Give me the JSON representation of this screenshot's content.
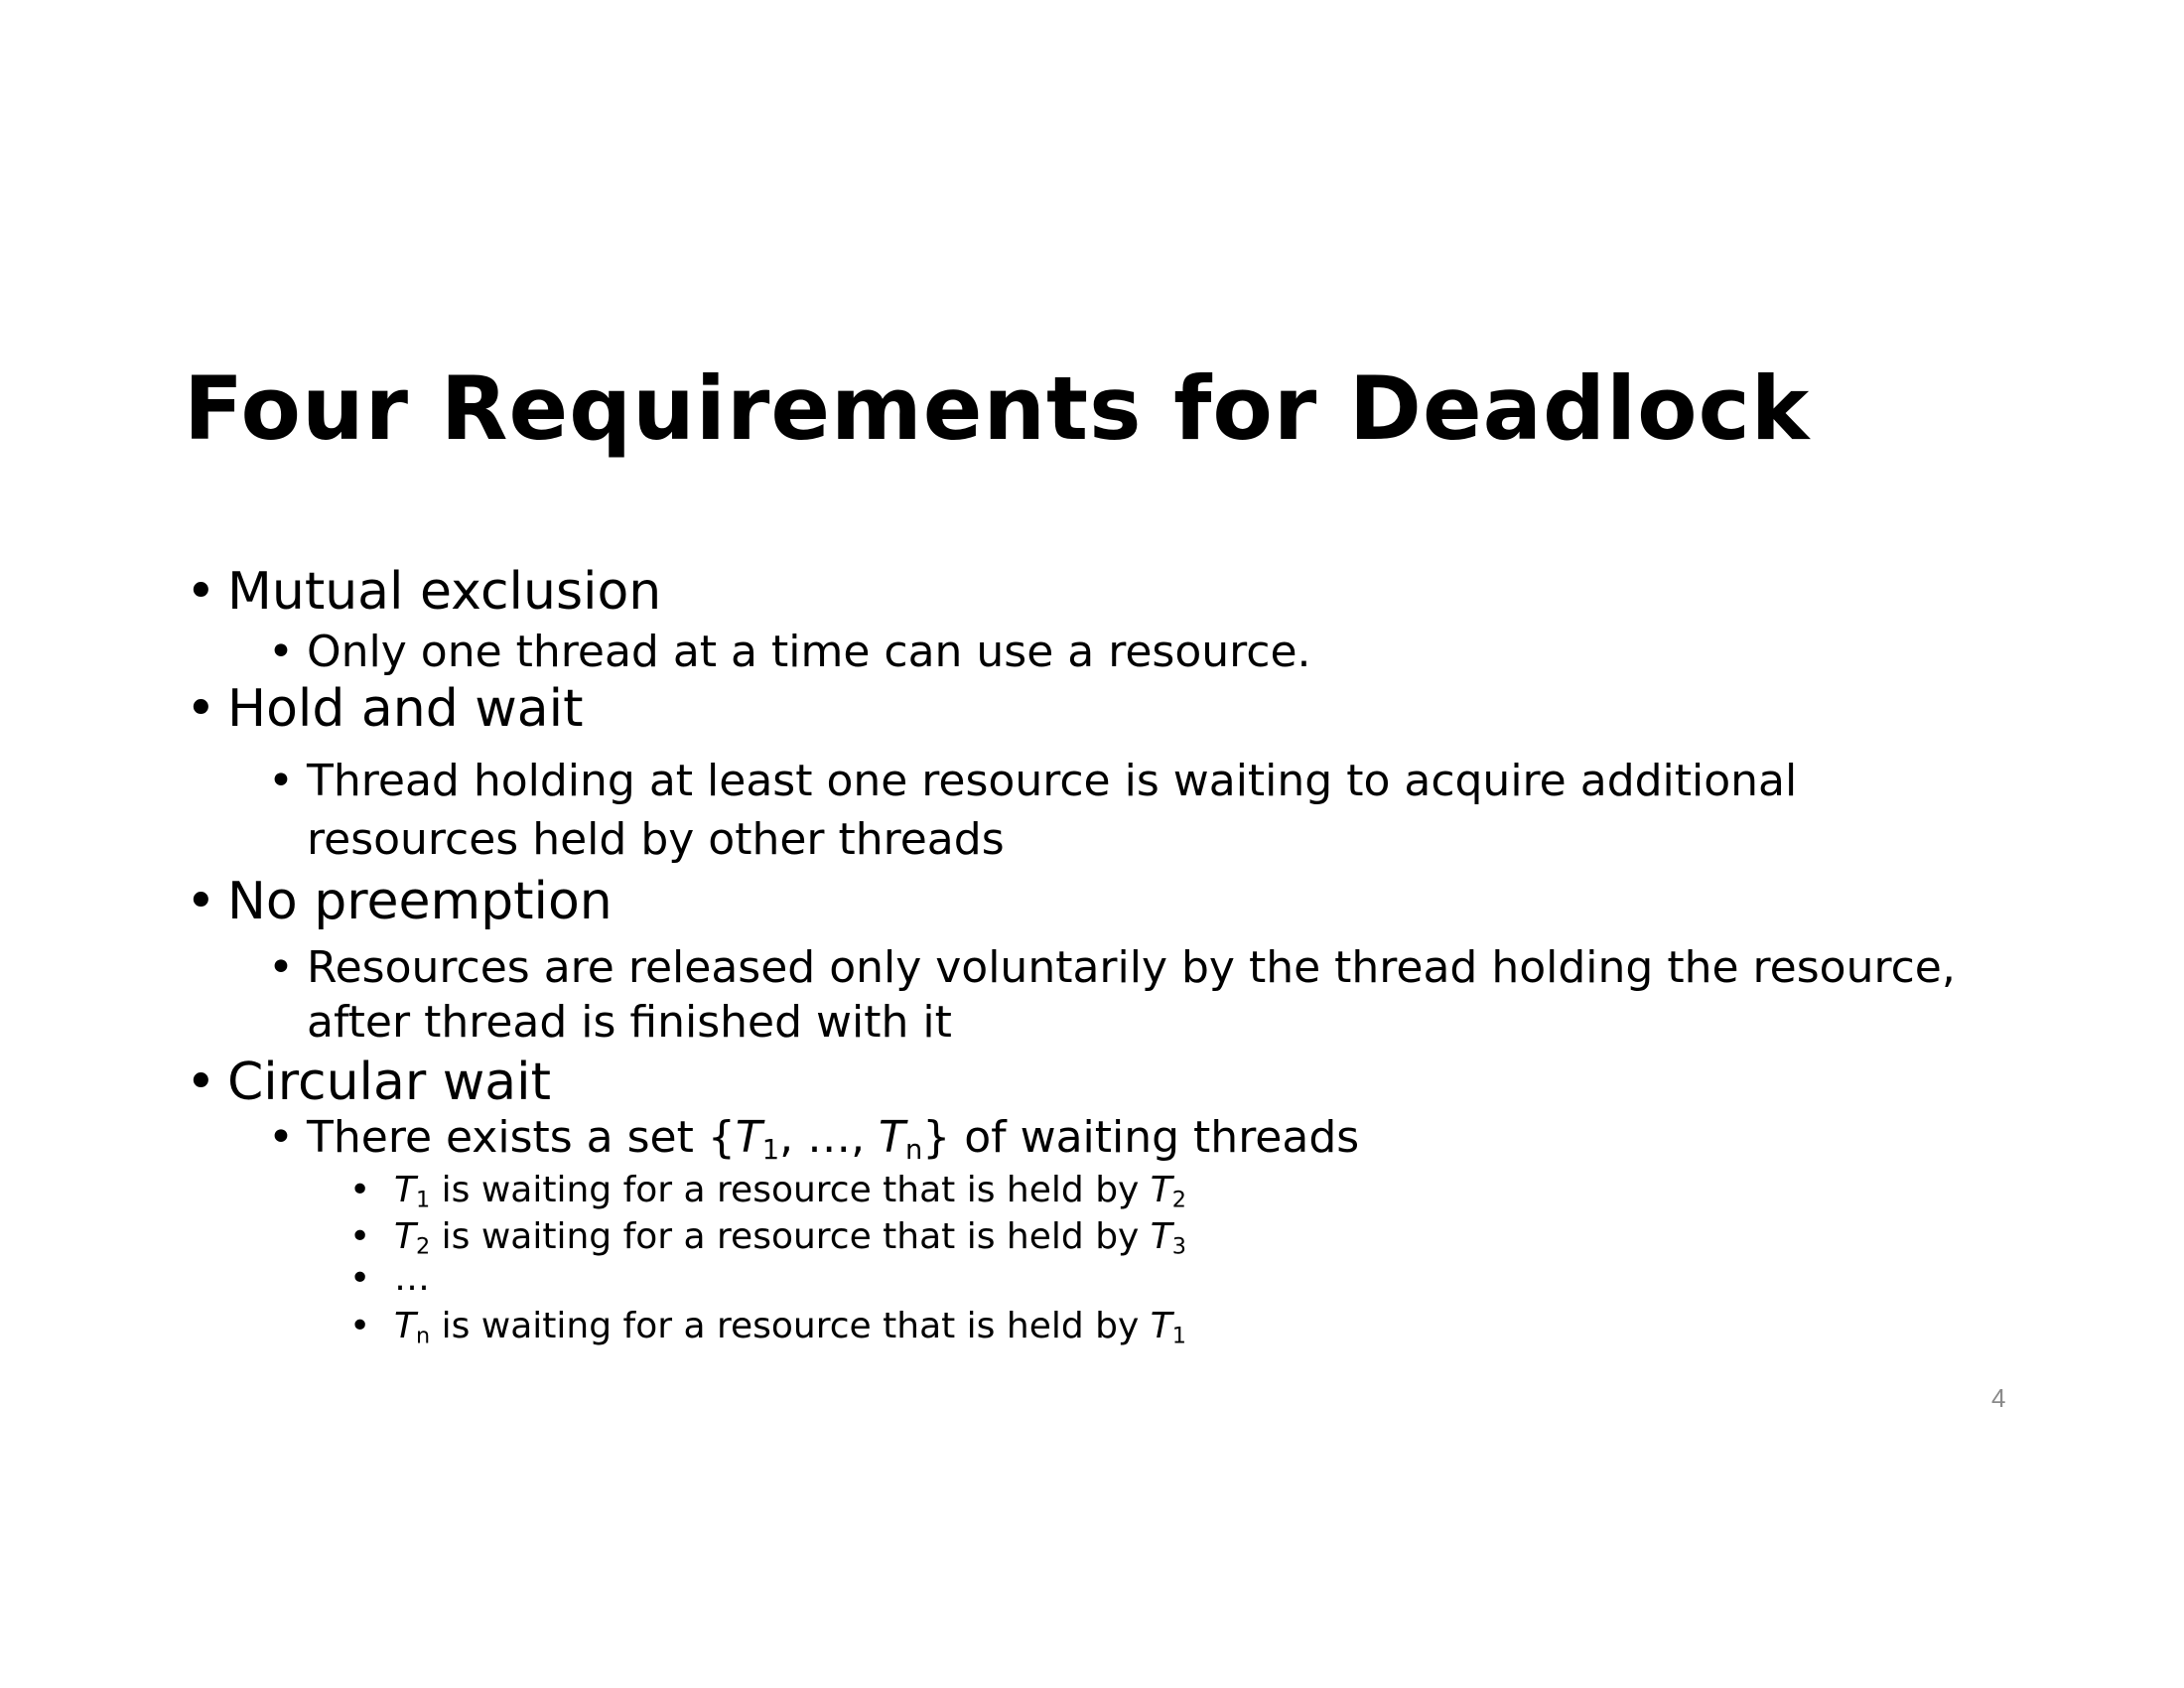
{
  "slide": {
    "title": "Four Requirements for Deadlock",
    "bullet_char": "•",
    "items": [
      {
        "label": "Mutual exclusion",
        "sub": [
          {
            "lines": [
              "Only one thread at a time can use a resource."
            ]
          }
        ]
      },
      {
        "label": "Hold and wait",
        "sub": [
          {
            "lines": [
              "Thread holding at least one resource is waiting to acquire additional",
              "resources held by other threads"
            ]
          }
        ]
      },
      {
        "label": "No preemption",
        "sub": [
          {
            "lines": [
              "Resources are released only voluntarily by the thread holding the resource,",
              "after thread is finished with it"
            ]
          }
        ]
      },
      {
        "label": "Circular wait",
        "sub": [
          {
            "prefix": "There exists a set {",
            "t_first": "T",
            "t_first_sub": "1",
            "sep": ", …, ",
            "t_last": "T",
            "t_last_sub": "n",
            "suffix": "} of waiting threads",
            "sub": [
              {
                "t_a": "T",
                "t_a_sub": "1",
                "text": " is waiting for a resource that is held by ",
                "t_b": "T",
                "t_b_sub": "2"
              },
              {
                "t_a": "T",
                "t_a_sub": "2",
                "text": " is waiting for a resource that is held by ",
                "t_b": "T",
                "t_b_sub": "3"
              },
              {
                "text": "…"
              },
              {
                "t_a": "T",
                "t_a_sub": "n",
                "text": " is waiting for a resource that is held by ",
                "t_b": "T",
                "t_b_sub": "1"
              }
            ]
          }
        ]
      }
    ],
    "page_number": "4"
  }
}
